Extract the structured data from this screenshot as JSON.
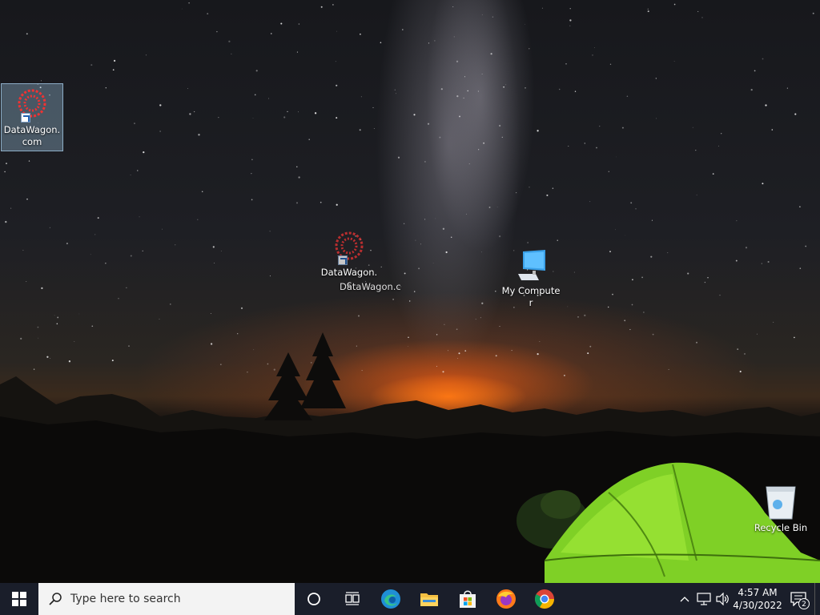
{
  "desktop": {
    "icons": {
      "datawagon_selected": {
        "label": "DataWagon.com"
      },
      "datawagon_center": {
        "label": "DataWagon.c"
      },
      "datawagon_drag": {
        "label": "DataWagon.c"
      },
      "my_computer": {
        "label": "My Computer"
      },
      "recycle_bin": {
        "label": "Recycle Bin"
      }
    }
  },
  "taskbar": {
    "search_placeholder": "Type here to search",
    "pinned": [
      "cortana-icon",
      "task-view-icon",
      "edge-icon",
      "file-explorer-icon",
      "store-icon",
      "firefox-icon",
      "chrome-icon"
    ],
    "clock": {
      "time": "4:57 AM",
      "date": "4/30/2022"
    },
    "notification_count": "2"
  },
  "colors": {
    "taskbar_bg": "#1a1e2a",
    "search_bg": "#f3f3f3",
    "accent": "#0078d7"
  }
}
